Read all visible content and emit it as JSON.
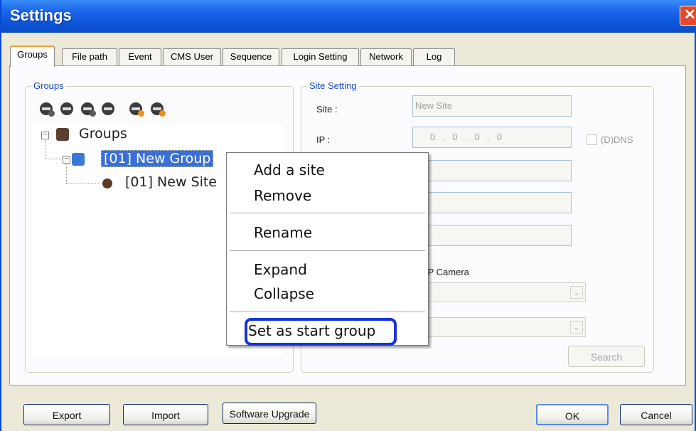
{
  "window": {
    "title": "Settings",
    "close_glyph": "✕"
  },
  "tabs": [
    {
      "label": "Groups",
      "active": true
    },
    {
      "label": "File path"
    },
    {
      "label": "Event"
    },
    {
      "label": "CMS User"
    },
    {
      "label": "Sequence"
    },
    {
      "label": "Login Setting"
    },
    {
      "label": "Network"
    },
    {
      "label": "Log"
    }
  ],
  "groups_panel": {
    "legend": "Groups",
    "toolbar_icons": [
      "add-group-icon",
      "remove-group-icon",
      "add-site-icon",
      "remove-site-icon",
      "move-up-icon",
      "move-down-icon"
    ],
    "tree": {
      "root_label": "Groups",
      "group_label": "[01] New Group",
      "site_label": "[01] New Site"
    }
  },
  "site_setting": {
    "legend": "Site Setting",
    "site_label": "Site :",
    "site_value": "New Site",
    "ip_label": "IP :",
    "ip_value": "0  .  0  .  0  .  0",
    "ddns_label": "(D)DNS",
    "ip_camera_label": "IP Camera",
    "search_button": "Search"
  },
  "context_menu": {
    "items": [
      "Add a site",
      "Remove",
      "Rename",
      "Expand",
      "Collapse",
      "Set as start group"
    ],
    "highlighted": "Set as start group"
  },
  "footer": {
    "export": "Export",
    "import": "Import",
    "software_upgrade": "Software Upgrade",
    "ok": "OK",
    "cancel": "Cancel"
  },
  "colors": {
    "titlebar": "#0c55d8",
    "selection": "#3a6fd8",
    "highlight_ring": "#1533d8",
    "tab_accent": "#f0a030"
  }
}
